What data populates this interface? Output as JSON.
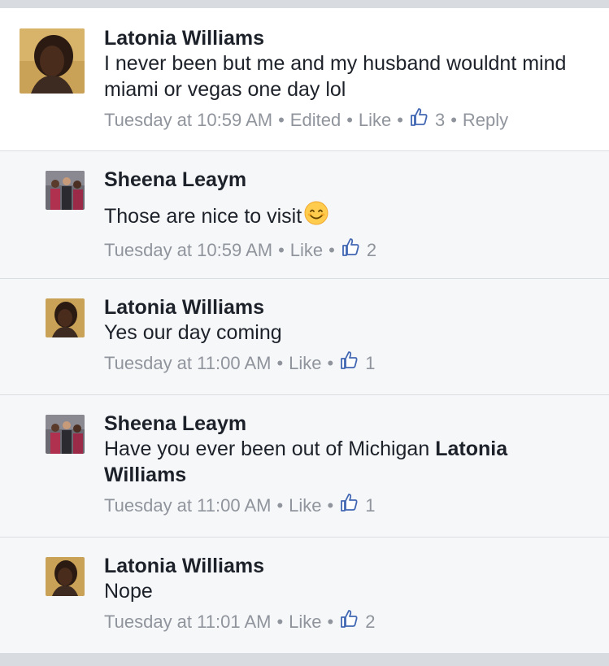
{
  "comments": [
    {
      "author": "Latonia Williams",
      "text": "I never been but me and my husband wouldnt mind miami or vegas one day lol",
      "time": "Tuesday at 10:59 AM",
      "edited": "Edited",
      "like": "Like",
      "likes": "3",
      "reply": "Reply"
    },
    {
      "author": "Sheena Leaym",
      "text": "Those are nice to visit",
      "emoji": "smiling-face-emoji",
      "time": "Tuesday at 10:59 AM",
      "like": "Like",
      "likes": "2"
    },
    {
      "author": "Latonia Williams",
      "text": "Yes our day coming",
      "time": "Tuesday at 11:00 AM",
      "like": "Like",
      "likes": "1"
    },
    {
      "author": "Sheena Leaym",
      "text": "Have you ever been out of Michigan ",
      "mention": "Latonia Williams",
      "time": "Tuesday at 11:00 AM",
      "like": "Like",
      "likes": "1"
    },
    {
      "author": "Latonia Williams",
      "text": "Nope",
      "time": "Tuesday at 11:01 AM",
      "like": "Like",
      "likes": "2"
    }
  ],
  "icons": {
    "like": "thumbs-up-icon",
    "separator": "•"
  },
  "colors": {
    "text": "#1d2129",
    "meta": "#90949c",
    "like_blue": "#4267b2"
  }
}
